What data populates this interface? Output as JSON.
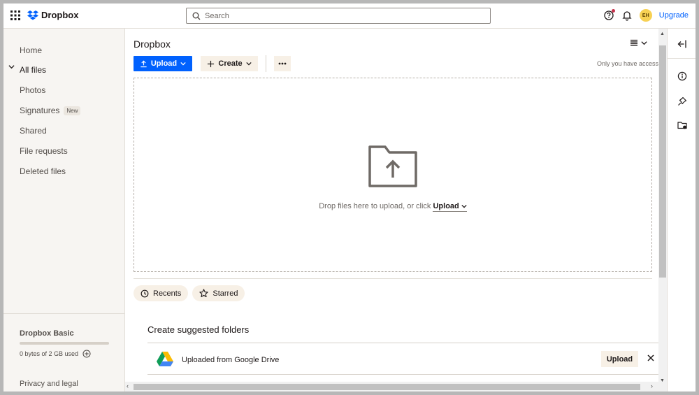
{
  "header": {
    "logo_text": "Dropbox",
    "search_placeholder": "Search",
    "avatar_initials": "EH",
    "upgrade_label": "Upgrade"
  },
  "sidebar": {
    "items": [
      {
        "label": "Home"
      },
      {
        "label": "All files"
      },
      {
        "label": "Photos"
      },
      {
        "label": "Signatures",
        "badge": "New"
      },
      {
        "label": "Shared"
      },
      {
        "label": "File requests"
      },
      {
        "label": "Deleted files"
      }
    ],
    "plan_name": "Dropbox Basic",
    "storage_text": "0 bytes of 2 GB used",
    "storage_fraction": 0,
    "privacy_label": "Privacy and legal"
  },
  "main": {
    "title": "Dropbox",
    "upload_label": "Upload",
    "create_label": "Create",
    "access_note": "Only you have access",
    "drop_text": "Drop files here to upload, or click",
    "drop_upload_label": "Upload",
    "chips": [
      {
        "label": "Recents"
      },
      {
        "label": "Starred"
      }
    ],
    "suggest_title": "Create suggested folders",
    "suggestion": {
      "name": "Uploaded from Google Drive",
      "upload_label": "Upload"
    }
  },
  "colors": {
    "accent": "#0061fe",
    "sidebar_bg": "#f7f5f2",
    "button_neutral_bg": "#f7f0e6",
    "avatar_bg": "#f7d154"
  }
}
